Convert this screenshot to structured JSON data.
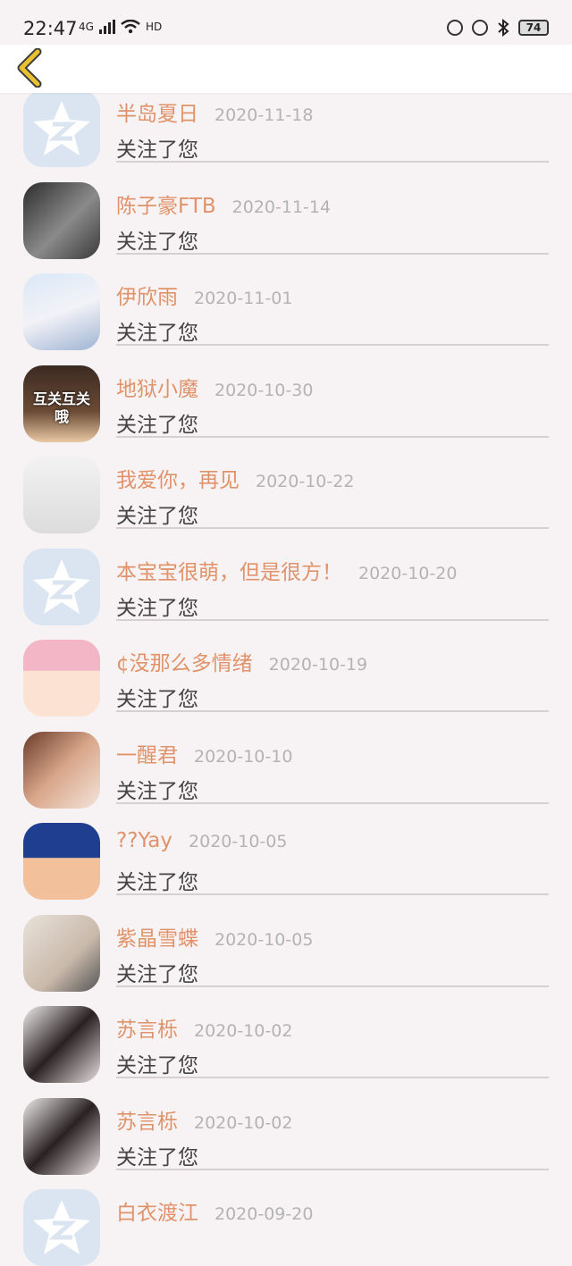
{
  "status_bar": {
    "time": "22:47",
    "network": "4G",
    "hd": "HD",
    "battery": "74"
  },
  "header": {
    "back_icon": "chevron-left-icon",
    "accent": "#e0b030"
  },
  "colors": {
    "name": "#e0936a",
    "date": "#b3b3b3",
    "action": "#444444"
  },
  "notifications": [
    {
      "name": "半岛夏日",
      "date": "2020-11-18",
      "action": "关注了您",
      "avatar": "default-qzone"
    },
    {
      "name": "陈子豪FTB",
      "date": "2020-11-14",
      "action": "关注了您",
      "avatar": "soldier"
    },
    {
      "name": "伊欣雨",
      "date": "2020-11-01",
      "action": "关注了您",
      "avatar": "anime-girl"
    },
    {
      "name": "地狱小魔",
      "date": "2020-10-30",
      "action": "关注了您",
      "avatar": "互关互关哦"
    },
    {
      "name": "我爱你，再见",
      "date": "2020-10-22",
      "action": "关注了您",
      "avatar": "boy-white"
    },
    {
      "name": "本宝宝很萌，但是很方！",
      "date": "2020-10-20",
      "action": "关注了您",
      "avatar": "default-qzone"
    },
    {
      "name": "¢没那么多情绪",
      "date": "2020-10-19",
      "action": "关注了您",
      "avatar": "pink-hat-cartoon"
    },
    {
      "name": "一醒君",
      "date": "2020-10-10",
      "action": "关注了您",
      "avatar": "girl-photo"
    },
    {
      "name": "??Yay",
      "date": "2020-10-05",
      "action": "关注了您",
      "avatar": "cartoon-kid"
    },
    {
      "name": "紫晶雪蝶",
      "date": "2020-10-05",
      "action": "关注了您",
      "avatar": "selfie"
    },
    {
      "name": "苏言栎",
      "date": "2020-10-02",
      "action": "关注了您",
      "avatar": "mirror-selfie"
    },
    {
      "name": "苏言栎",
      "date": "2020-10-02",
      "action": "关注了您",
      "avatar": "mirror-selfie"
    },
    {
      "name": "白衣渡江",
      "date": "2020-09-20",
      "action": "",
      "avatar": "default-qzone"
    }
  ]
}
